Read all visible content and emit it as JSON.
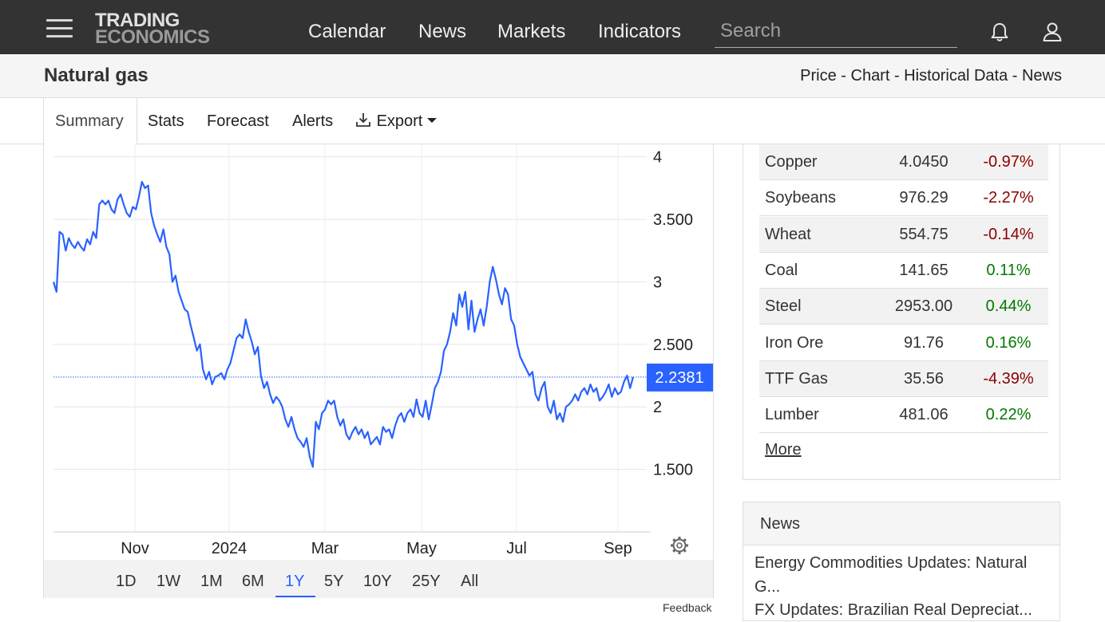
{
  "header": {
    "logo_line1": "TRADING",
    "logo_line2": "ECONOMICS",
    "nav": [
      "Calendar",
      "News",
      "Markets",
      "Indicators"
    ],
    "search_placeholder": "Search",
    "icons": [
      "menu-icon",
      "bell-icon",
      "user-icon"
    ]
  },
  "title_bar": {
    "title": "Natural gas",
    "links": "Price - Chart - Historical Data - News"
  },
  "tabs": {
    "summary": "Summary",
    "stats": "Stats",
    "forecast": "Forecast",
    "alerts": "Alerts",
    "export": "Export"
  },
  "chart_data": {
    "type": "line",
    "title": "",
    "xlabel": "",
    "ylabel": "",
    "x_ticks": [
      "Nov",
      "2024",
      "Mar",
      "May",
      "Jul",
      "Sep"
    ],
    "y_ticks": [
      "1.500",
      "2",
      "2.500",
      "3",
      "3.500",
      "4"
    ],
    "ylim": [
      1.0,
      4.1
    ],
    "current_value": "2.2381",
    "colors": {
      "line": "#2962ff",
      "price_label_bg": "#2962ff"
    },
    "series": [
      {
        "values": [
          3.0,
          2.92,
          3.4,
          3.38,
          3.25,
          3.35,
          3.3,
          3.27,
          3.32,
          3.28,
          3.25,
          3.34,
          3.3,
          3.4,
          3.35,
          3.62,
          3.65,
          3.62,
          3.65,
          3.58,
          3.55,
          3.66,
          3.7,
          3.62,
          3.55,
          3.52,
          3.6,
          3.58,
          3.68,
          3.8,
          3.75,
          3.77,
          3.55,
          3.45,
          3.38,
          3.32,
          3.42,
          3.28,
          3.22,
          3.0,
          3.05,
          2.92,
          2.85,
          2.78,
          2.76,
          2.65,
          2.55,
          2.45,
          2.5,
          2.3,
          2.22,
          2.28,
          2.18,
          2.24,
          2.25,
          2.27,
          2.22,
          2.3,
          2.35,
          2.45,
          2.55,
          2.58,
          2.55,
          2.7,
          2.6,
          2.52,
          2.42,
          2.48,
          2.25,
          2.15,
          2.2,
          2.1,
          2.03,
          2.08,
          2.05,
          2.0,
          1.9,
          1.84,
          1.92,
          1.82,
          1.75,
          1.72,
          1.68,
          1.75,
          1.6,
          1.52,
          1.88,
          1.82,
          1.95,
          1.98,
          2.05,
          2.02,
          2.05,
          1.92,
          1.85,
          1.9,
          1.78,
          1.74,
          1.8,
          1.84,
          1.78,
          1.82,
          1.75,
          1.8,
          1.7,
          1.73,
          1.76,
          1.7,
          1.84,
          1.8,
          1.82,
          1.75,
          1.85,
          1.92,
          1.95,
          1.88,
          1.95,
          1.98,
          1.92,
          2.06,
          1.95,
          1.92,
          2.05,
          1.9,
          2.02,
          2.15,
          2.2,
          2.28,
          2.45,
          2.5,
          2.6,
          2.75,
          2.65,
          2.9,
          2.8,
          2.92,
          2.62,
          2.85,
          2.6,
          2.7,
          2.78,
          2.65,
          2.8,
          3.0,
          3.12,
          3.02,
          2.9,
          2.82,
          2.95,
          2.9,
          2.7,
          2.65,
          2.5,
          2.4,
          2.35,
          2.3,
          2.25,
          2.28,
          2.1,
          2.05,
          2.15,
          2.2,
          2.0,
          1.95,
          2.05,
          1.9,
          1.95,
          1.88,
          2.0,
          2.02,
          2.05,
          2.1,
          2.05,
          2.12,
          2.15,
          2.1,
          2.18,
          2.12,
          2.15,
          2.05,
          2.08,
          2.12,
          2.18,
          2.08,
          2.15,
          2.1,
          2.12,
          2.2,
          2.25,
          2.15,
          2.24
        ]
      }
    ],
    "grid": true
  },
  "range_buttons": [
    "1D",
    "1W",
    "1M",
    "6M",
    "1Y",
    "5Y",
    "10Y",
    "25Y",
    "All"
  ],
  "range_active": "1Y",
  "feedback": "Feedback",
  "commodities": [
    {
      "name": "Copper",
      "price": "4.0450",
      "change": "-0.97%",
      "color": "#8b0000"
    },
    {
      "name": "Soybeans",
      "price": "976.29",
      "change": "-2.27%",
      "color": "#8b0000"
    },
    {
      "name": "Wheat",
      "price": "554.75",
      "change": "-0.14%",
      "color": "#8b0000"
    },
    {
      "name": "Coal",
      "price": "141.65",
      "change": "0.11%",
      "color": "#007a00"
    },
    {
      "name": "Steel",
      "price": "2953.00",
      "change": "0.44%",
      "color": "#007a00"
    },
    {
      "name": "Iron Ore",
      "price": "91.76",
      "change": "0.16%",
      "color": "#007a00"
    },
    {
      "name": "TTF Gas",
      "price": "35.56",
      "change": "-4.39%",
      "color": "#8b0000"
    },
    {
      "name": "Lumber",
      "price": "481.06",
      "change": "0.22%",
      "color": "#007a00"
    }
  ],
  "more": "More",
  "news": {
    "header": "News",
    "items": [
      "Energy Commodities Updates: Natural G...",
      "FX Updates: Brazilian Real Depreciat..."
    ]
  }
}
